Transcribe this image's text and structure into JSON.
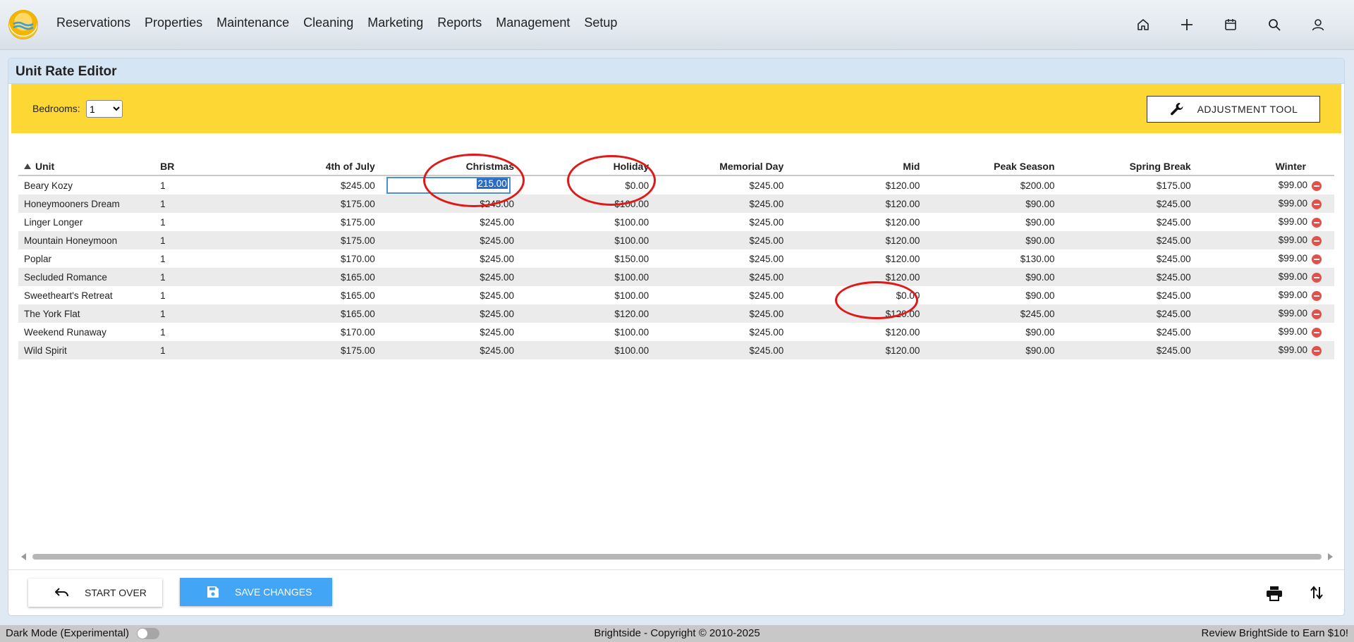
{
  "nav": {
    "items": [
      "Reservations",
      "Properties",
      "Maintenance",
      "Cleaning",
      "Marketing",
      "Reports",
      "Management",
      "Setup"
    ],
    "icons": [
      "home-icon",
      "plus-icon",
      "calendar-icon",
      "search-icon",
      "user-icon"
    ]
  },
  "page": {
    "title": "Unit Rate Editor",
    "bedrooms_label": "Bedrooms:",
    "bedrooms_value": "1",
    "adjustment_label": "ADJUSTMENT TOOL"
  },
  "table": {
    "columns": [
      "Unit",
      "BR",
      "4th of July",
      "Christmas",
      "Holiday",
      "Memorial Day",
      "Mid",
      "Peak Season",
      "Spring Break",
      "Winter"
    ],
    "rows": [
      {
        "unit": "Beary Kozy",
        "br": "1",
        "july4": "$245.00",
        "christmas": "215.00",
        "holiday": "$0.00",
        "memorial": "$245.00",
        "mid": "$120.00",
        "peak": "$200.00",
        "spring": "$175.00",
        "winter": "$99.00"
      },
      {
        "unit": "Honeymooners Dream",
        "br": "1",
        "july4": "$175.00",
        "christmas": "$245.00",
        "holiday": "$100.00",
        "memorial": "$245.00",
        "mid": "$120.00",
        "peak": "$90.00",
        "spring": "$245.00",
        "winter": "$99.00"
      },
      {
        "unit": "Linger Longer",
        "br": "1",
        "july4": "$175.00",
        "christmas": "$245.00",
        "holiday": "$100.00",
        "memorial": "$245.00",
        "mid": "$120.00",
        "peak": "$90.00",
        "spring": "$245.00",
        "winter": "$99.00"
      },
      {
        "unit": "Mountain Honeymoon",
        "br": "1",
        "july4": "$175.00",
        "christmas": "$245.00",
        "holiday": "$100.00",
        "memorial": "$245.00",
        "mid": "$120.00",
        "peak": "$90.00",
        "spring": "$245.00",
        "winter": "$99.00"
      },
      {
        "unit": "Poplar",
        "br": "1",
        "july4": "$170.00",
        "christmas": "$245.00",
        "holiday": "$150.00",
        "memorial": "$245.00",
        "mid": "$120.00",
        "peak": "$130.00",
        "spring": "$245.00",
        "winter": "$99.00"
      },
      {
        "unit": "Secluded Romance",
        "br": "1",
        "july4": "$165.00",
        "christmas": "$245.00",
        "holiday": "$100.00",
        "memorial": "$245.00",
        "mid": "$120.00",
        "peak": "$90.00",
        "spring": "$245.00",
        "winter": "$99.00"
      },
      {
        "unit": "Sweetheart's Retreat",
        "br": "1",
        "july4": "$165.00",
        "christmas": "$245.00",
        "holiday": "$100.00",
        "memorial": "$245.00",
        "mid": "$0.00",
        "peak": "$90.00",
        "spring": "$245.00",
        "winter": "$99.00"
      },
      {
        "unit": "The York Flat",
        "br": "1",
        "july4": "$165.00",
        "christmas": "$245.00",
        "holiday": "$120.00",
        "memorial": "$245.00",
        "mid": "$120.00",
        "peak": "$245.00",
        "spring": "$245.00",
        "winter": "$99.00"
      },
      {
        "unit": "Weekend Runaway",
        "br": "1",
        "july4": "$170.00",
        "christmas": "$245.00",
        "holiday": "$100.00",
        "memorial": "$245.00",
        "mid": "$120.00",
        "peak": "$90.00",
        "spring": "$245.00",
        "winter": "$99.00"
      },
      {
        "unit": "Wild Spirit",
        "br": "1",
        "july4": "$175.00",
        "christmas": "$245.00",
        "holiday": "$100.00",
        "memorial": "$245.00",
        "mid": "$120.00",
        "peak": "$90.00",
        "spring": "$245.00",
        "winter": "$99.00"
      }
    ]
  },
  "actions": {
    "start_over": "START OVER",
    "save": "SAVE CHANGES"
  },
  "status": {
    "dark_mode": "Dark Mode (Experimental)",
    "copyright": "Brightside - Copyright © 2010-2025",
    "review": "Review BrightSide to Earn $10!"
  },
  "colors": {
    "filter_bar": "#fdd835",
    "save_button": "#42a5f5",
    "annotation_ring": "#e01818",
    "delete_icon": "#e2504a"
  }
}
